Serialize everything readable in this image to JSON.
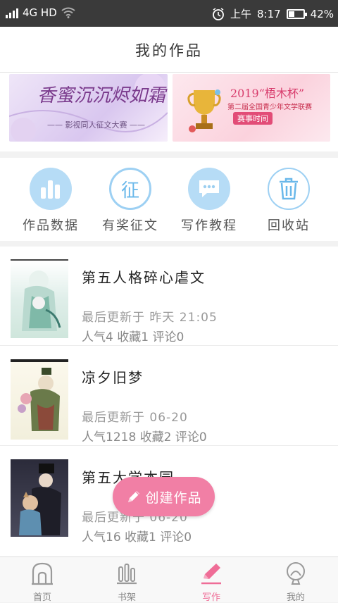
{
  "status_bar": {
    "network": "4G HD",
    "time_prefix": "上午",
    "time": "8:17",
    "battery": "42%",
    "battery_level": 0.42
  },
  "header": {
    "title": "我的作品"
  },
  "banners": [
    {
      "title": "香蜜沉沉烬如霜",
      "subtitle": "—— 影视同人征文大赛 ——"
    },
    {
      "title": "2019“梧木杯”",
      "subtitle": "第二届全国青少年文学联赛",
      "tag": "赛事时间"
    }
  ],
  "tools": [
    {
      "label": "作品数据",
      "icon": "bar-chart-icon"
    },
    {
      "label": "有奖征文",
      "icon": "contest-icon",
      "glyph": "征"
    },
    {
      "label": "写作教程",
      "icon": "chat-bubble-icon"
    },
    {
      "label": "回收站",
      "icon": "trash-icon"
    }
  ],
  "works": [
    {
      "title": "第五人格碎心虐文",
      "updated": "最后更新于  昨天 21:05",
      "stats": "人气4 收藏1 评论0"
    },
    {
      "title": "凉夕旧梦",
      "updated": "最后更新于  06-20",
      "stats": "人气1218 收藏2 评论0"
    },
    {
      "title": "第五大学本园",
      "updated": "最后更新于  06-20",
      "stats": "人气16 收藏1 评论0"
    }
  ],
  "fab": {
    "label": "创建作品"
  },
  "tabs": [
    {
      "label": "首页",
      "icon": "home-icon"
    },
    {
      "label": "书架",
      "icon": "bookshelf-icon"
    },
    {
      "label": "写作",
      "icon": "pen-icon"
    },
    {
      "label": "我的",
      "icon": "profile-icon"
    }
  ],
  "colors": {
    "accent": "#f17fa5",
    "tool_fill": "#b6dcf6",
    "tool_icon": "#5aaee5",
    "active_tab": "#ef6d97"
  }
}
